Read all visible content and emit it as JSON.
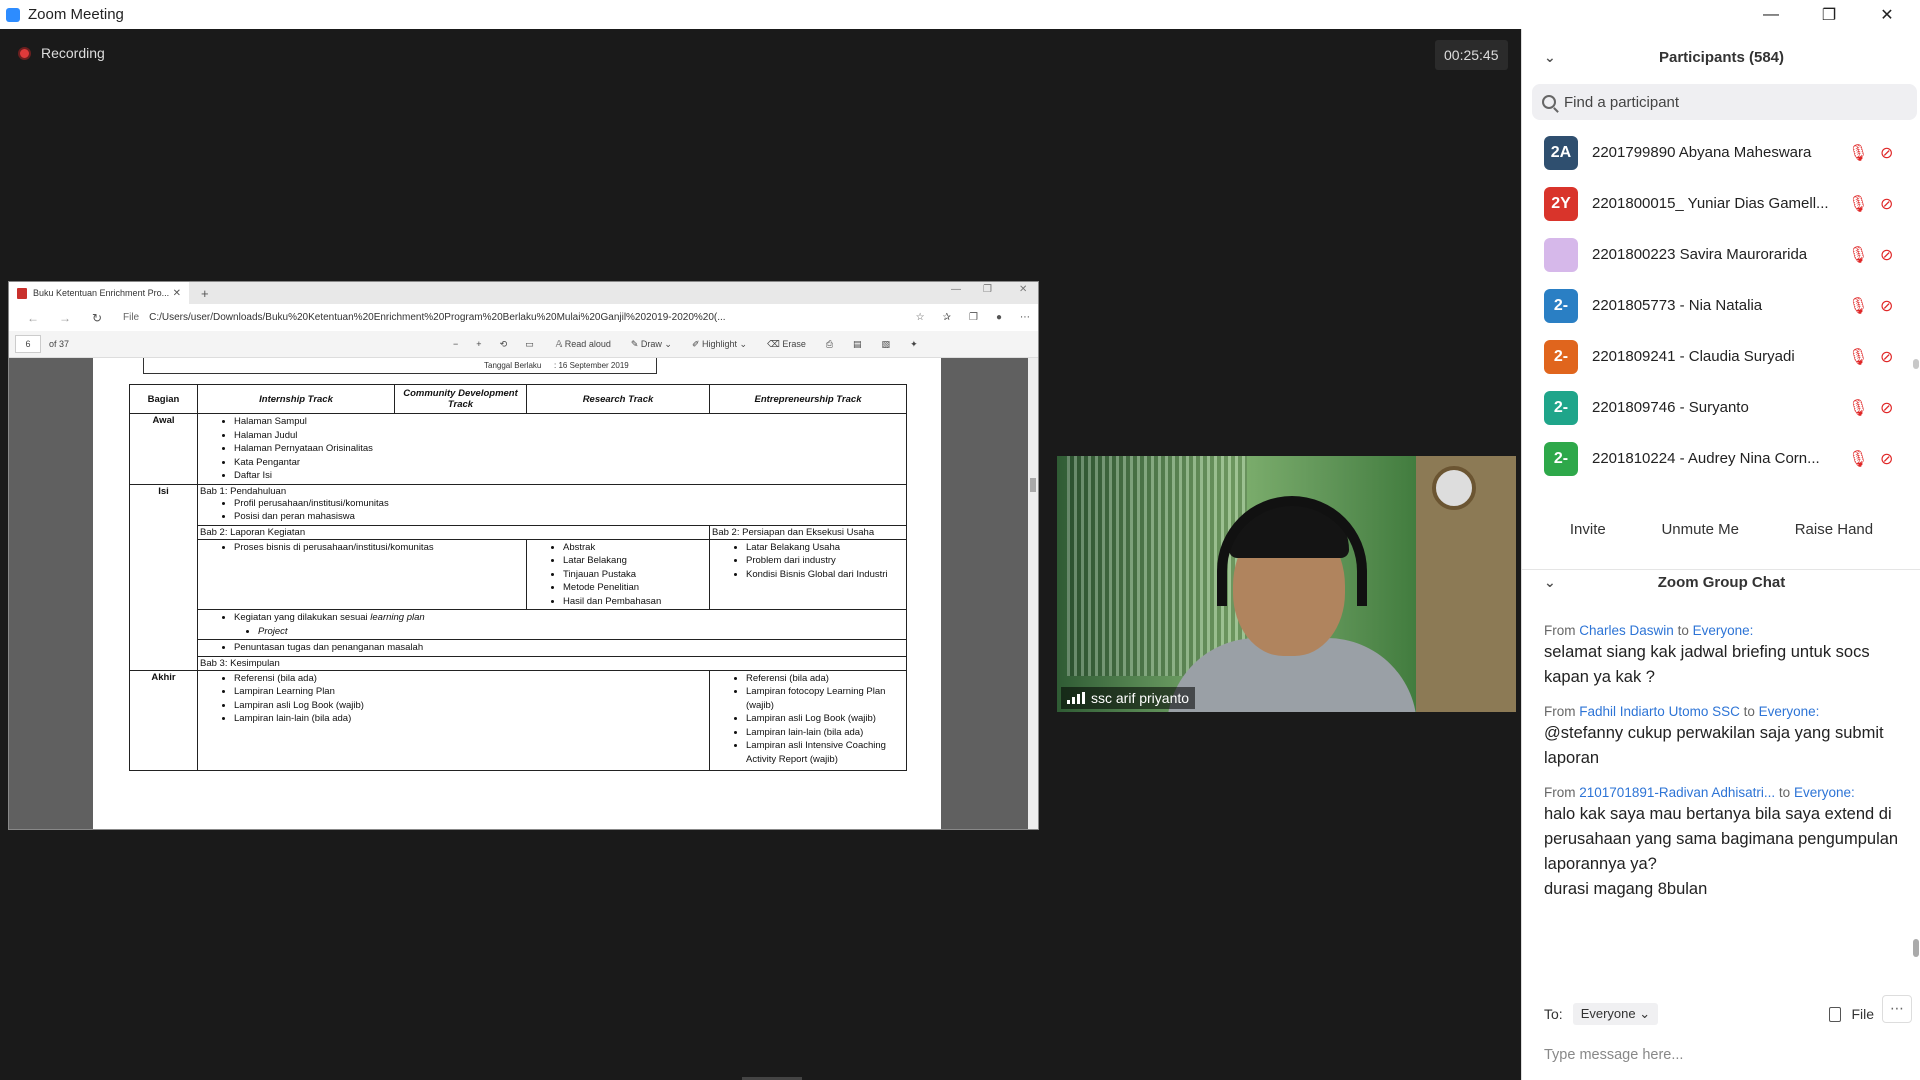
{
  "window": {
    "title": "Zoom Meeting",
    "controls": [
      "—",
      "❐",
      "✕"
    ]
  },
  "meeting": {
    "recording_label": "Recording",
    "timer": "00:25:45"
  },
  "browser": {
    "tab_title": "Buku Ketentuan Enrichment Pro...",
    "address": {
      "file_label": "File",
      "url": "C:/Users/user/Downloads/Buku%20Ketentuan%20Enrichment%20Program%20Berlaku%20Mulai%20Ganjil%202019-2020%20(..."
    },
    "pdf_toolbar": {
      "page": "6",
      "of": "of 37",
      "read_aloud": "Read aloud",
      "draw": "Draw",
      "highlight": "Highlight",
      "erase": "Erase"
    },
    "doc": {
      "effective_label": "Tanggal Berlaku",
      "effective_date": ": 16 September 2019",
      "headers": [
        "Bagian",
        "Internship Track",
        "Community Development Track",
        "Research Track",
        "Entrepreneurship Track"
      ],
      "awal": {
        "label": "Awal",
        "items": [
          "Halaman Sampul",
          "Halaman Judul",
          "Halaman Pernyataan Orisinalitas",
          "Kata Pengantar",
          "Daftar Isi"
        ]
      },
      "isi": {
        "label": "Isi",
        "bab1": "Bab 1: Pendahuluan",
        "bab1_items": [
          "Profil perusahaan/institusi/komunitas",
          "Posisi dan peran mahasiswa"
        ],
        "bab2": "Bab 2: Laporan Kegiatan",
        "bab2_ent": "Bab 2: Persiapan dan Eksekusi Usaha",
        "proses": "Proses bisnis di perusahaan/institusi/komunitas",
        "research_items": [
          "Abstrak",
          "Latar Belakang",
          "Tinjauan Pustaka",
          "Metode Penelitian",
          "Hasil dan Pembahasan"
        ],
        "ent_items": [
          "Latar Belakang Usaha",
          "Problem dari industry",
          "Kondisi Bisnis Global dari Industri"
        ],
        "kegiatan": "Kegiatan yang dilakukan sesuai",
        "learning_plan": "learning plan",
        "project": "Project",
        "penuntasan": "Penuntasan tugas dan penanganan masalah",
        "bab3": "Bab 3: Kesimpulan"
      },
      "akhir": {
        "label": "Akhir",
        "left_items": [
          "Referensi (bila ada)",
          "Lampiran Learning Plan",
          "Lampiran asli Log Book (wajib)",
          "Lampiran lain-lain (bila ada)"
        ],
        "right_items": [
          "Referensi (bila ada)",
          "Lampiran fotocopy Learning Plan (wajib)",
          "Lampiran asli Log Book (wajib)",
          "Lampiran lain-lain (bila ada)",
          "Lampiran asli Intensive Coaching Activity Report (wajib)"
        ]
      }
    }
  },
  "video": {
    "name": "ssc arif priyanto"
  },
  "participants": {
    "title": "Participants (584)",
    "search_placeholder": "Find a participant",
    "list": [
      {
        "initials": "2A",
        "color": "#2f4f6f",
        "name": "2201799890 Abyana Maheswara"
      },
      {
        "initials": "2Y",
        "color": "#d9342b",
        "name": "2201800015_ Yuniar Dias Gamell..."
      },
      {
        "initials": "",
        "color": "#d6b8ea",
        "name": "2201800223 Savira Maurorarida"
      },
      {
        "initials": "2-",
        "color": "#2a7fc4",
        "name": "2201805773 - Nia Natalia"
      },
      {
        "initials": "2-",
        "color": "#e0651d",
        "name": "2201809241 - Claudia Suryadi"
      },
      {
        "initials": "2-",
        "color": "#1fa58a",
        "name": "2201809746 - Suryanto"
      },
      {
        "initials": "2-",
        "color": "#2ea84a",
        "name": "2201810224 - Audrey Nina Corn..."
      }
    ],
    "buttons": {
      "invite": "Invite",
      "unmute": "Unmute Me",
      "raise": "Raise Hand"
    }
  },
  "chat": {
    "title": "Zoom Group Chat",
    "messages": [
      {
        "from": "Charles Daswin",
        "to": "Everyone:",
        "text": "selamat siang kak jadwal briefing untuk socs kapan ya kak ?"
      },
      {
        "from": "Fadhil Indiarto Utomo SSC",
        "to": "Everyone:",
        "text": "@stefanny cukup perwakilan saja yang submit laporan"
      },
      {
        "from": "2101701891-Radivan Adhisatri...",
        "to": "Everyone:",
        "text": "halo kak saya mau bertanya bila saya extend di perusahaan yang sama bagimana pengumpulan laporannya ya?"
      },
      {
        "from": "",
        "to": "",
        "text": "durasi magang 8bulan"
      }
    ],
    "from_word": "From",
    "to_word": "to",
    "to_label": "To:",
    "to_value": "Everyone",
    "file_label": "File",
    "input_placeholder": "Type message here..."
  }
}
